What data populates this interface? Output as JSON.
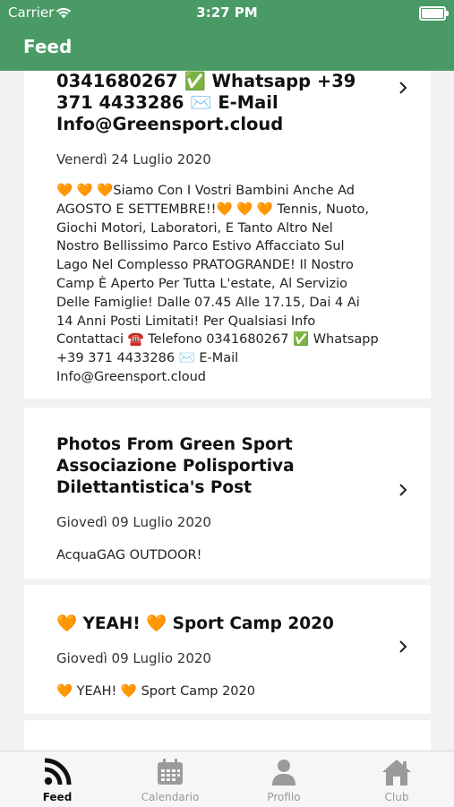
{
  "status_bar": {
    "carrier": "Carrier",
    "time": "3:27 PM"
  },
  "nav": {
    "title": "Feed"
  },
  "feed": {
    "items": [
      {
        "title": "0341680267 ✅ Whatsapp +39 371 4433286 ✉️ E-Mail Info@Greensport.cloud",
        "date": "Venerdì 24 Luglio 2020",
        "body": "🧡 🧡 🧡Siamo Con I Vostri Bambini Anche Ad AGOSTO E SETTEMBRE!!🧡 🧡 🧡 Tennis, Nuoto, Giochi Motori, Laboratori, E Tanto Altro Nel Nostro Bellissimo Parco Estivo Affacciato Sul Lago Nel Complesso PRATOGRANDE! Il Nostro Camp È Aperto Per Tutta L'estate, Al Servizio Delle Famiglie! Dalle 07.45 Alle 17.15, Dai 4 Ai 14 Anni Posti Limitati! Per Qualsiasi Info Contattaci ☎️ Telefono 0341680267 ✅ Whatsapp +39 371 4433286 ✉️ E-Mail Info@Greensport.cloud"
      },
      {
        "title": "Photos From Green Sport Associazione Polisportiva Dilettantistica's Post",
        "date": "Giovedì 09 Luglio 2020",
        "body": "AcquaGAG OUTDOOR!"
      },
      {
        "title": "🧡 YEAH! 🧡 Sport Camp 2020",
        "date": "Giovedì 09 Luglio 2020",
        "body": "🧡 YEAH! 🧡 Sport Camp 2020"
      }
    ]
  },
  "tabbar": {
    "tabs": [
      {
        "label": "Feed",
        "icon": "rss-feed-icon",
        "active": true
      },
      {
        "label": "Calendario",
        "icon": "calendar-icon",
        "active": false
      },
      {
        "label": "Profilo",
        "icon": "person-icon",
        "active": false
      },
      {
        "label": "Club",
        "icon": "home-icon",
        "active": false
      }
    ]
  },
  "colors": {
    "header": "#4a9a65",
    "background": "#f1f2f4",
    "tab_inactive": "#999999",
    "tab_active": "#111111"
  }
}
